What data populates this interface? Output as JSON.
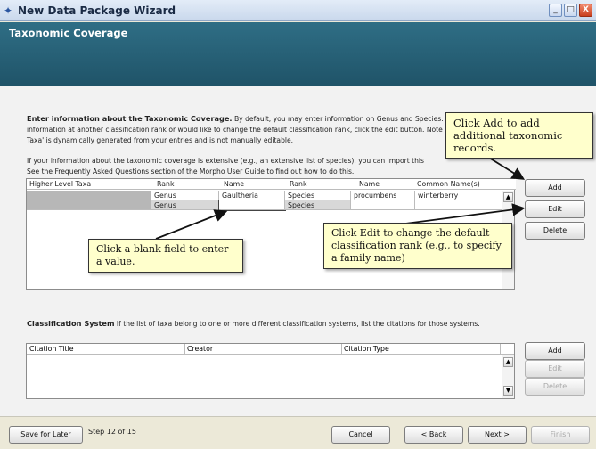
{
  "window": {
    "title": "New Data Package Wizard",
    "minimize": "_",
    "maximize": "□",
    "close": "X"
  },
  "header": {
    "title": "Taxonomic Coverage"
  },
  "description": {
    "line1_bold": "Enter information about the Taxonomic Coverage.",
    "line1_rest": " By default, you may enter information on Genus and Species. If you would like to enter",
    "line2": "information at another classification rank or would like to change the default classification rank, click the edit button. Note that the field 'Higher Level",
    "line3": "Taxa' is dynamically generated from your entries and is not manually editable.",
    "line4": "If your information about the taxonomic coverage is extensive (e.g., an extensive list of species), you can import this",
    "line5": "See the Frequently Asked Questions section of the Morpho User Guide to find out how to do this."
  },
  "taxa_table": {
    "columns": [
      "Higher Level Taxa",
      "Rank",
      "Name",
      "Rank",
      "Name",
      "Common Name(s)"
    ],
    "rows": [
      [
        "",
        "Genus",
        "Gaultheria",
        "Species",
        "procumbens",
        "winterberry"
      ],
      [
        "",
        "Genus",
        "",
        "Species",
        "",
        ""
      ]
    ]
  },
  "taxa_buttons": {
    "add": "Add",
    "edit": "Edit",
    "delete": "Delete"
  },
  "callouts": {
    "add": "Click Add to add additional taxonomic records.",
    "edit": "Click Edit to change the default classification rank (e.g., to specify a family name)",
    "blank": "Click a blank field to enter a value."
  },
  "classification": {
    "label_bold": "Classification System",
    "label_rest": " If the list of taxa belong to one or more different classification systems, list the citations for those systems.",
    "columns": [
      "Citation Title",
      "Creator",
      "Citation Type"
    ],
    "buttons": {
      "add": "Add",
      "edit": "Edit",
      "delete": "Delete"
    }
  },
  "footer": {
    "save_later": "Save for Later",
    "step": "Step 12 of 15",
    "cancel": "Cancel",
    "back": "< Back",
    "next": "Next >",
    "finish": "Finish"
  },
  "colors": {
    "header_bg": "#2f6e85",
    "callout_bg": "#ffffcc"
  }
}
